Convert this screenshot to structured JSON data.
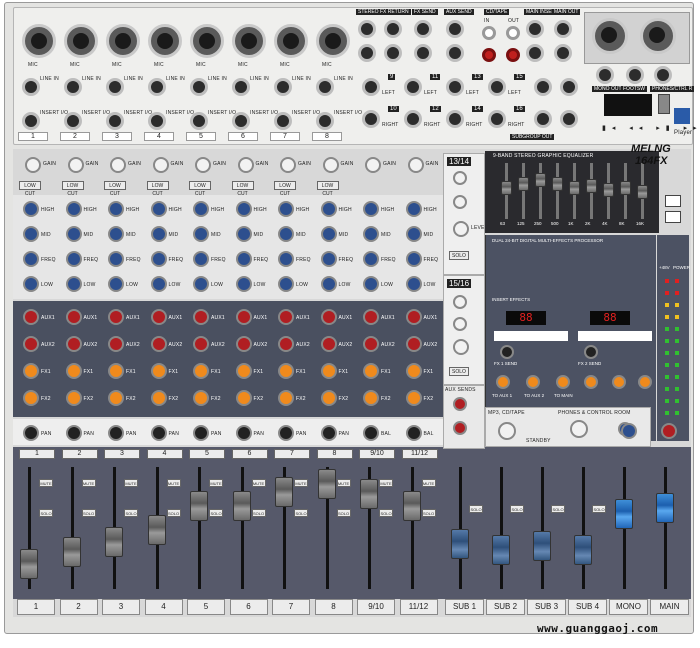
{
  "brand": {
    "name": "MELNG",
    "model": "164FX"
  },
  "rear": {
    "channels": [
      "1",
      "2",
      "3",
      "4",
      "5",
      "6",
      "7",
      "8"
    ],
    "mic_label": "MIC",
    "line_in_label": "LINE IN",
    "insert_label": "INSERT I/O",
    "stereo_fx_return": "STEREO FX RETURN",
    "fx_send": "FX SEND",
    "aux_send": "AUX SEND",
    "cd_tape": "CD/TAPE",
    "in_label": "IN",
    "out_label": "OUT",
    "main_insert": "MAIN INSERT",
    "main_out": "MAIN OUT",
    "mono_out": "MONO OUT",
    "footsw": "FOOTSW",
    "phones": "PHONES/CTRL R",
    "player": "Player",
    "subgroup_out": "SUBGROUP OUT",
    "subgroup_nums": [
      "9",
      "10",
      "11",
      "12",
      "13",
      "14",
      "15",
      "16"
    ],
    "left": "LEFT",
    "right": "RIGHT"
  },
  "strips": {
    "labels": [
      "1",
      "2",
      "3",
      "4",
      "5",
      "6",
      "7",
      "8",
      "9/10",
      "11/12"
    ],
    "gain": "GAIN",
    "low_cut": "LOW CUT",
    "eq": "EQ",
    "high": "HIGH",
    "mid": "MID",
    "freq": "FREQ",
    "low": "LOW",
    "aux": "AUX",
    "aux1": "AUX1",
    "aux2": "AUX2",
    "fx1": "FX1",
    "fx2": "FX2",
    "pre": "PRE",
    "pan": "PAN",
    "bal": "BAL",
    "mute": "MUTE",
    "solo": "SOLO"
  },
  "returns": {
    "a": "13/14",
    "b": "15/16",
    "level": "LEVEL",
    "solo": "SOLO",
    "aux_sends": "AUX SENDS"
  },
  "geq": {
    "title": "9-BAND STEREO GRAPHIC EQUALIZER",
    "bands": [
      "63",
      "125",
      "250",
      "500",
      "1K",
      "2K",
      "4K",
      "8K",
      "16K"
    ]
  },
  "fx": {
    "title": "DUAL 24-BIT DIGITAL MULTI-EFFECTS PROCESSOR",
    "display_a": "88",
    "display_b": "88",
    "fx1_send": "FX 1 SEND",
    "fx2_send": "FX 2 SEND",
    "insert_effects": "INSERT EFFECTS",
    "to_aux1": "TO AUX 1",
    "to_aux2": "TO AUX 2",
    "to_main": "TO MAIN",
    "power": "POWER",
    "v48": "+48V"
  },
  "control_room": {
    "mp3": "MP3, CD/TAPE",
    "phones": "PHONES & CONTROL ROOM",
    "standby": "STANDBY"
  },
  "busses": [
    "SUB 1",
    "SUB 2",
    "SUB 3",
    "SUB 4",
    "MONO",
    "MAIN"
  ],
  "watermark": "www.guanggaoj.com"
}
